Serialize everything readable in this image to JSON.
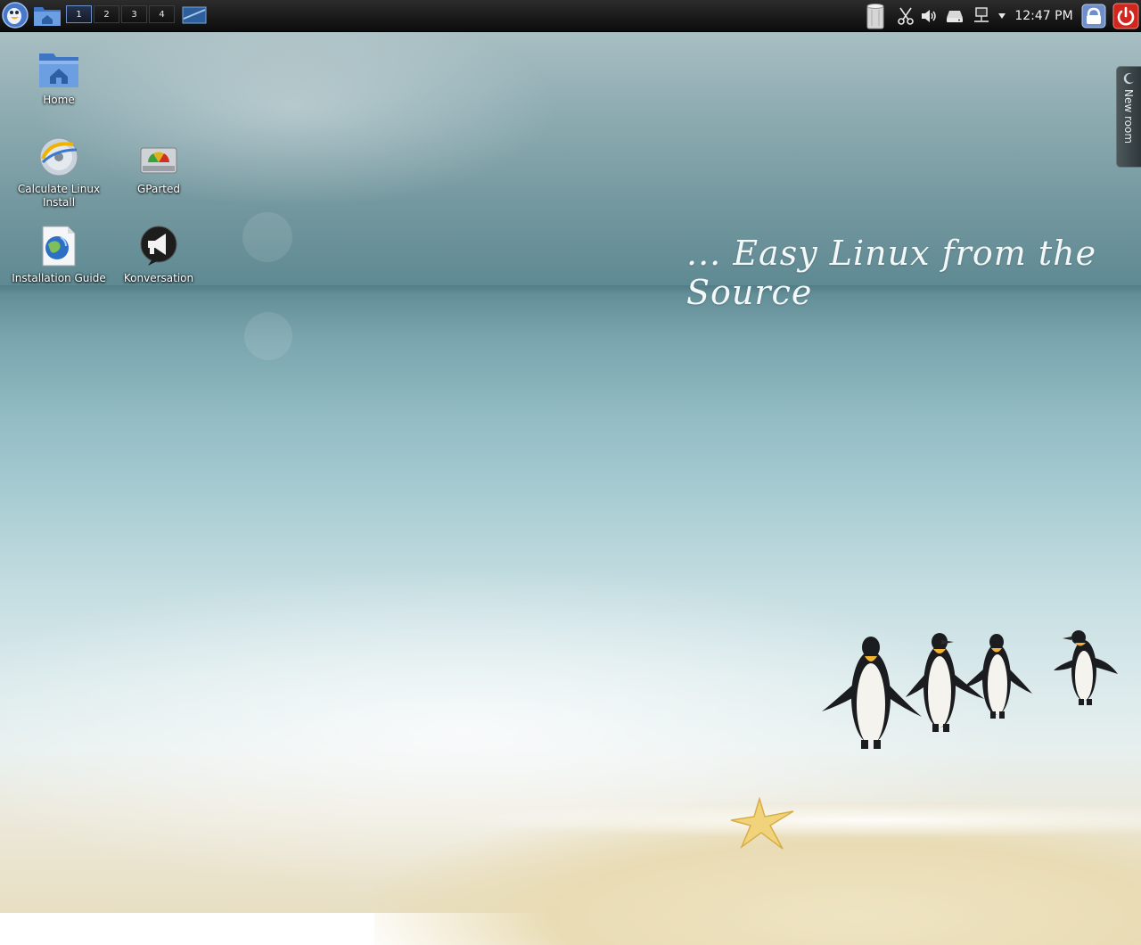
{
  "panel": {
    "workspaces": [
      "1",
      "2",
      "3",
      "4"
    ],
    "active_workspace": "1",
    "clock": "12:47 PM",
    "icons": {
      "launcher": "app-launcher-icon",
      "home_folder": "home-folder-icon",
      "show_desktop": "show-desktop-icon",
      "trash": "trash-icon",
      "clipboard": "scissors-icon",
      "volume": "speaker-icon",
      "storage": "device-icon",
      "network": "network-icon",
      "tray_expand": "chevron-down-icon",
      "lock": "lock-icon",
      "power": "power-icon"
    },
    "colors": {
      "power_button": "#d0261e",
      "lock_button": "#6e8fcc"
    }
  },
  "desktop": {
    "slogan": "... Easy Linux from the Source",
    "icons": [
      {
        "label": "Home",
        "icon": "home-folder-icon"
      },
      {
        "label": "Calculate Linux Install",
        "icon": "installer-disc-icon"
      },
      {
        "label": "GParted",
        "icon": "gparted-icon"
      },
      {
        "label": "Installation Guide",
        "icon": "guide-document-icon"
      },
      {
        "label": "Konversation",
        "icon": "konversation-icon"
      }
    ]
  },
  "activity_tab": {
    "label": "New room"
  }
}
